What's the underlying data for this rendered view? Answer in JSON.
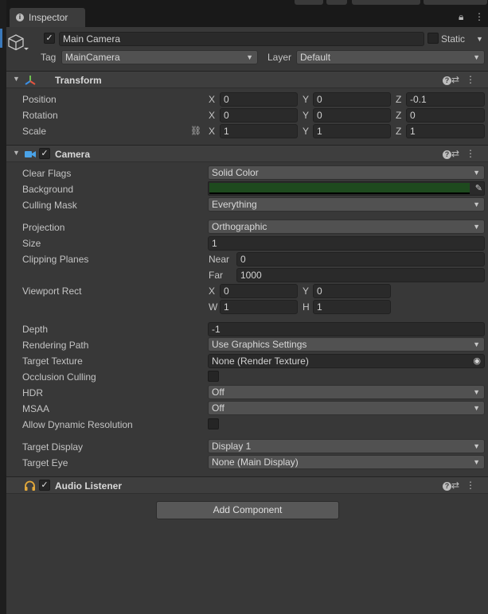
{
  "tab": {
    "label": "Inspector"
  },
  "header": {
    "name": "Main Camera",
    "static_label": "Static",
    "tag_label": "Tag",
    "tag_value": "MainCamera",
    "layer_label": "Layer",
    "layer_value": "Default"
  },
  "transform": {
    "title": "Transform",
    "position": {
      "label": "Position",
      "x": "0",
      "y": "0",
      "z": "-0.1"
    },
    "rotation": {
      "label": "Rotation",
      "x": "0",
      "y": "0",
      "z": "0"
    },
    "scale": {
      "label": "Scale",
      "x": "1",
      "y": "1",
      "z": "1"
    }
  },
  "axes": {
    "x": "X",
    "y": "Y",
    "z": "Z",
    "w": "W",
    "h": "H"
  },
  "camera": {
    "title": "Camera",
    "background_color": "#1e4a1e",
    "rows": {
      "clear_flags": {
        "label": "Clear Flags",
        "value": "Solid Color"
      },
      "background": {
        "label": "Background"
      },
      "culling_mask": {
        "label": "Culling Mask",
        "value": "Everything"
      },
      "projection": {
        "label": "Projection",
        "value": "Orthographic"
      },
      "size": {
        "label": "Size",
        "value": "1"
      },
      "clipping_planes": {
        "label": "Clipping Planes",
        "near_label": "Near",
        "near": "0",
        "far_label": "Far",
        "far": "1000"
      },
      "viewport_rect": {
        "label": "Viewport Rect",
        "x": "0",
        "y": "0",
        "w": "1",
        "h": "1"
      },
      "depth": {
        "label": "Depth",
        "value": "-1"
      },
      "rendering_path": {
        "label": "Rendering Path",
        "value": "Use Graphics Settings"
      },
      "target_texture": {
        "label": "Target Texture",
        "value": "None (Render Texture)"
      },
      "occlusion_culling": {
        "label": "Occlusion Culling"
      },
      "hdr": {
        "label": "HDR",
        "value": "Off"
      },
      "msaa": {
        "label": "MSAA",
        "value": "Off"
      },
      "allow_dynamic_resolution": {
        "label": "Allow Dynamic Resolution"
      },
      "target_display": {
        "label": "Target Display",
        "value": "Display 1"
      },
      "target_eye": {
        "label": "Target Eye",
        "value": "None (Main Display)"
      }
    }
  },
  "audio_listener": {
    "title": "Audio Listener"
  },
  "add_component": {
    "label": "Add Component"
  },
  "icons": {
    "gameobject": "cube-icon",
    "transform": "transform-axes-icon",
    "camera": "camera-icon",
    "audio": "headphones-icon",
    "help": "help-icon",
    "presets": "sliders-icon",
    "menu": "kebab-menu-icon",
    "lock": "lock-icon",
    "constrain": "link-icon"
  }
}
